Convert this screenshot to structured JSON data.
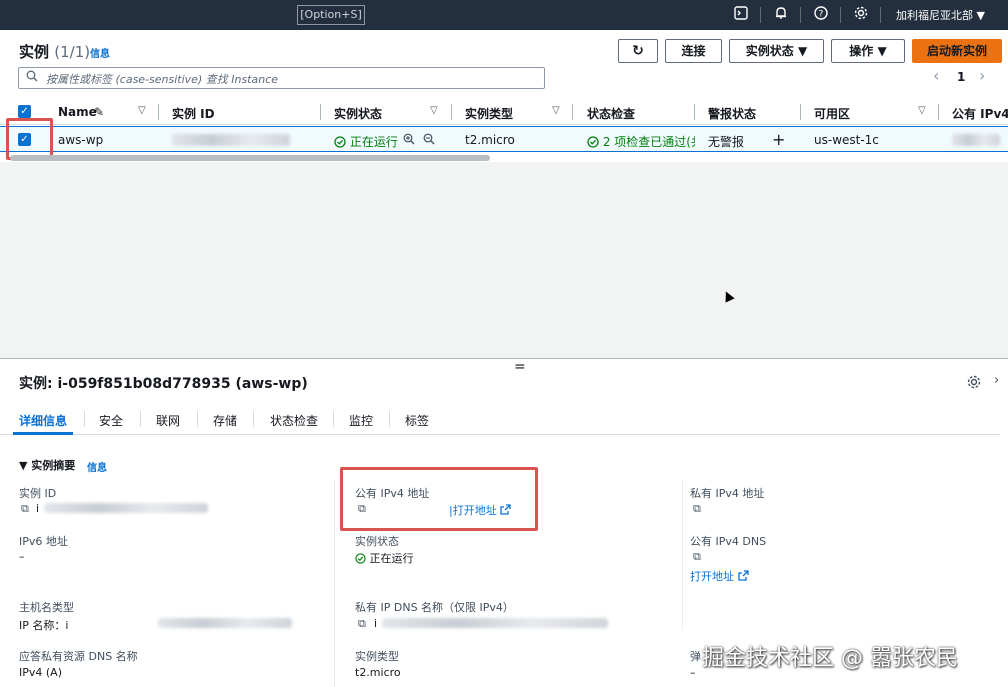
{
  "topnav": {
    "shortcut": "[Option+S]",
    "icons": [
      "cloudshell-icon",
      "notifications-icon",
      "help-icon",
      "settings-icon"
    ],
    "region": "加利福尼亚北部 ▼"
  },
  "instances": {
    "title": "实例",
    "count": "(1/1)",
    "info": "信息",
    "buttons": {
      "refresh": "↻",
      "connect": "连接",
      "instance_state": "实例状态 ▼",
      "actions": "操作 ▼",
      "launch": "启动新实例"
    },
    "search_placeholder": "按属性或标签 (case-sensitive) 查找 Instance",
    "pager": {
      "prev": "‹",
      "page": "1",
      "next": "›"
    },
    "columns": [
      "Name",
      "实例 ID",
      "实例状态",
      "实例类型",
      "状态检查",
      "警报状态",
      "可用区",
      "公有 IPv4"
    ],
    "row": {
      "name": "aws-wp",
      "state": "正在运行",
      "type": "t2.micro",
      "status_check": "2 项检查已通过(共",
      "alarm": "无警报",
      "alarm_add": "+",
      "az": "us-west-1c"
    }
  },
  "details": {
    "drag": "=",
    "title": "实例: i-059f851b08d778935 (aws-wp)",
    "tabs": [
      "详细信息",
      "安全",
      "联网",
      "存储",
      "状态检查",
      "监控",
      "标签"
    ],
    "section": "▼ 实例摘要",
    "section_info": "信息",
    "fields": {
      "instance_id_label": "实例 ID",
      "instance_id_value": "i",
      "public_ipv4_label": "公有 IPv4 地址",
      "open_address": "|打开地址",
      "private_ipv4_label": "私有 IPv4 地址",
      "ipv6_label": "IPv6 地址",
      "ipv6_value": "–",
      "state_label": "实例状态",
      "state_value": "正在运行",
      "public_dns_label": "公有 IPv4 DNS",
      "open_address2": "打开地址",
      "hostname_type_label": "主机名类型",
      "hostname_type_value": "IP 名称：i",
      "private_dns_label": "私有 IP DNS 名称（仅限 IPv4）",
      "private_dns_value": "i",
      "answer_dns_label": "应答私有资源 DNS 名称",
      "answer_dns_value": "IPv4 (A)",
      "instance_type_label": "实例类型",
      "instance_type_value": "t2.micro",
      "elastic_label": "弹",
      "elastic_value": "–"
    }
  },
  "watermark": "掘金技术社区 @ 嚣张农民",
  "colors": {
    "nav_bg": "#232f3e",
    "primary": "#ec7211",
    "link": "#0972d3",
    "success": "#037f0c",
    "highlight": "#d9534f"
  }
}
